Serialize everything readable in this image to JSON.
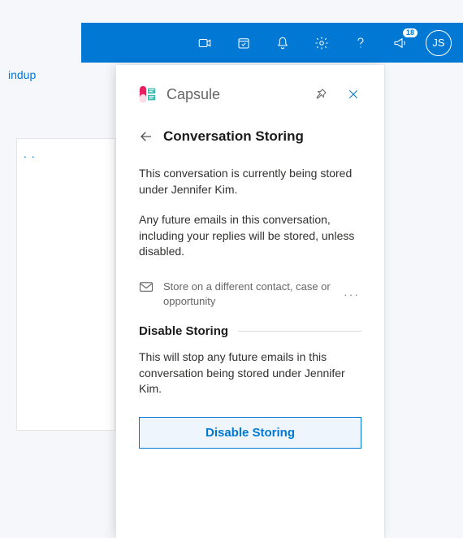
{
  "topbar": {
    "badge_count": "18",
    "avatar_initials": "JS"
  },
  "left_pane": {
    "truncated_label": "indup"
  },
  "panel": {
    "app_name": "Capsule",
    "heading": "Conversation Storing",
    "para1": "This conversation is currently being stored under Jennifer Kim.",
    "para2": "Any future emails in this conversation, including your replies will be stored, unless disabled.",
    "store_alt_label": "Store on a different contact, case or opportunity",
    "disable_heading": "Disable Storing",
    "disable_para": "This will stop any future emails in this conversation being stored under Jennifer Kim.",
    "disable_button": "Disable Storing"
  }
}
